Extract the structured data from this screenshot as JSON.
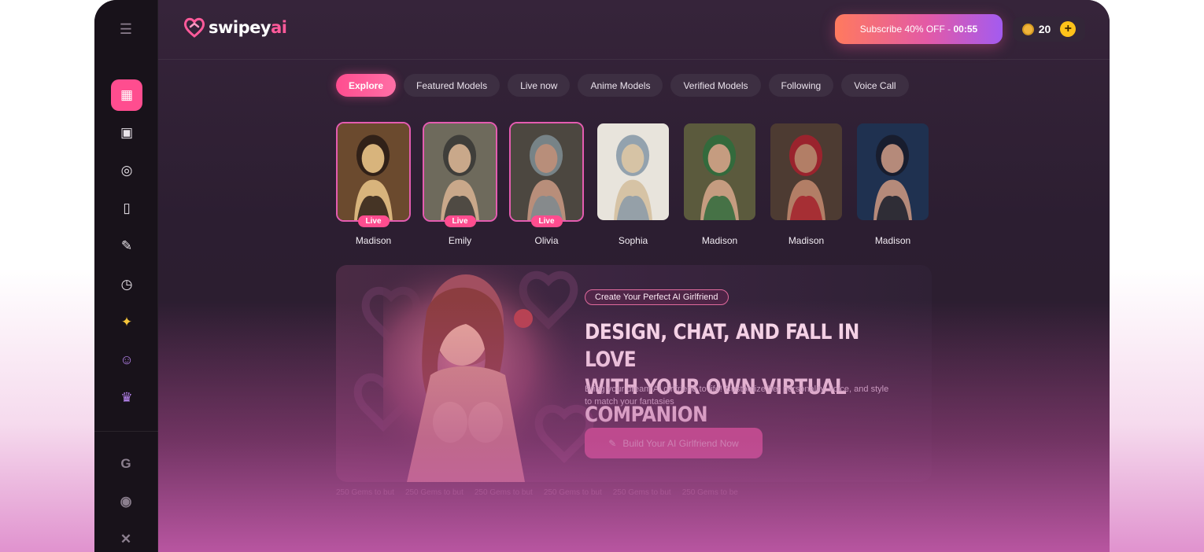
{
  "brand": {
    "name_main": "swipey",
    "name_accent": "ai"
  },
  "header": {
    "subscribe_label": "Subscribe 40% OFF - ",
    "subscribe_timer": "00:55",
    "coin_count": "20"
  },
  "sidebar": {
    "items": [
      {
        "name": "explore",
        "icon": "grid-icon",
        "glyph": "▦",
        "active": true
      },
      {
        "name": "gallery",
        "icon": "image-gallery-icon",
        "glyph": "▣"
      },
      {
        "name": "chat",
        "icon": "chat-bubble-icon",
        "glyph": "◎"
      },
      {
        "name": "cards",
        "icon": "cards-icon",
        "glyph": "▯"
      },
      {
        "name": "generate",
        "icon": "magic-wand-icon",
        "glyph": "✎"
      },
      {
        "name": "history",
        "icon": "history-icon",
        "glyph": "◷"
      },
      {
        "name": "premium",
        "icon": "sparkles-icon",
        "glyph": "✦"
      },
      {
        "name": "affiliate",
        "icon": "users-icon",
        "glyph": "☺"
      },
      {
        "name": "community",
        "icon": "group-icon",
        "glyph": "♛"
      }
    ],
    "social": [
      {
        "name": "google",
        "glyph": "G"
      },
      {
        "name": "discord",
        "glyph": "◉"
      },
      {
        "name": "x",
        "glyph": "✕"
      }
    ]
  },
  "filters": [
    {
      "label": "Explore",
      "active": true
    },
    {
      "label": "Featured Models"
    },
    {
      "label": "Live now"
    },
    {
      "label": "Anime Models"
    },
    {
      "label": "Verified Models"
    },
    {
      "label": "Following"
    },
    {
      "label": "Voice Call"
    }
  ],
  "models": [
    {
      "name": "Madison",
      "live": true,
      "palette": [
        "#6b4a2e",
        "#d8b47c",
        "#2b1d16"
      ]
    },
    {
      "name": "Emily",
      "live": true,
      "palette": [
        "#6e6a5c",
        "#c9a88a",
        "#3a3a36"
      ]
    },
    {
      "name": "Olivia",
      "live": true,
      "palette": [
        "#4c4740",
        "#b88e7a",
        "#7c8a8f"
      ]
    },
    {
      "name": "Sophia",
      "live": false,
      "palette": [
        "#e8e4dc",
        "#d6c3a5",
        "#8a9aa8"
      ]
    },
    {
      "name": "Madison",
      "live": false,
      "palette": [
        "#5b5a3d",
        "#c59c80",
        "#2f6b3c"
      ]
    },
    {
      "name": "Madison",
      "live": false,
      "palette": [
        "#4d3b32",
        "#b27e66",
        "#a3212c"
      ]
    },
    {
      "name": "Madison",
      "live": false,
      "palette": [
        "#1f3150",
        "#b58a7a",
        "#171c2a"
      ]
    }
  ],
  "live_label": "Live",
  "hero": {
    "tag": "Create Your Perfect AI Girlfriend",
    "title_line1": "DESIGN, CHAT, AND FALL IN LOVE",
    "title_line2": "WITH YOUR OWN VIRTUAL COMPANION",
    "description": "Bring your dream AI girlfriend to life! Customize her personality, voice, and style to match your fantasies",
    "cta": "Build Your AI Girlfriend Now"
  },
  "ticker": [
    "250 Gems to but",
    "250 Gems to but",
    "250 Gems to but",
    "250 Gems to but",
    "250 Gems to but",
    "250 Gems to be"
  ],
  "colors": {
    "accent": "#ff4d8f",
    "background": "#2a1d2e",
    "sidebar": "#18121a",
    "coin": "#ffc21a"
  }
}
